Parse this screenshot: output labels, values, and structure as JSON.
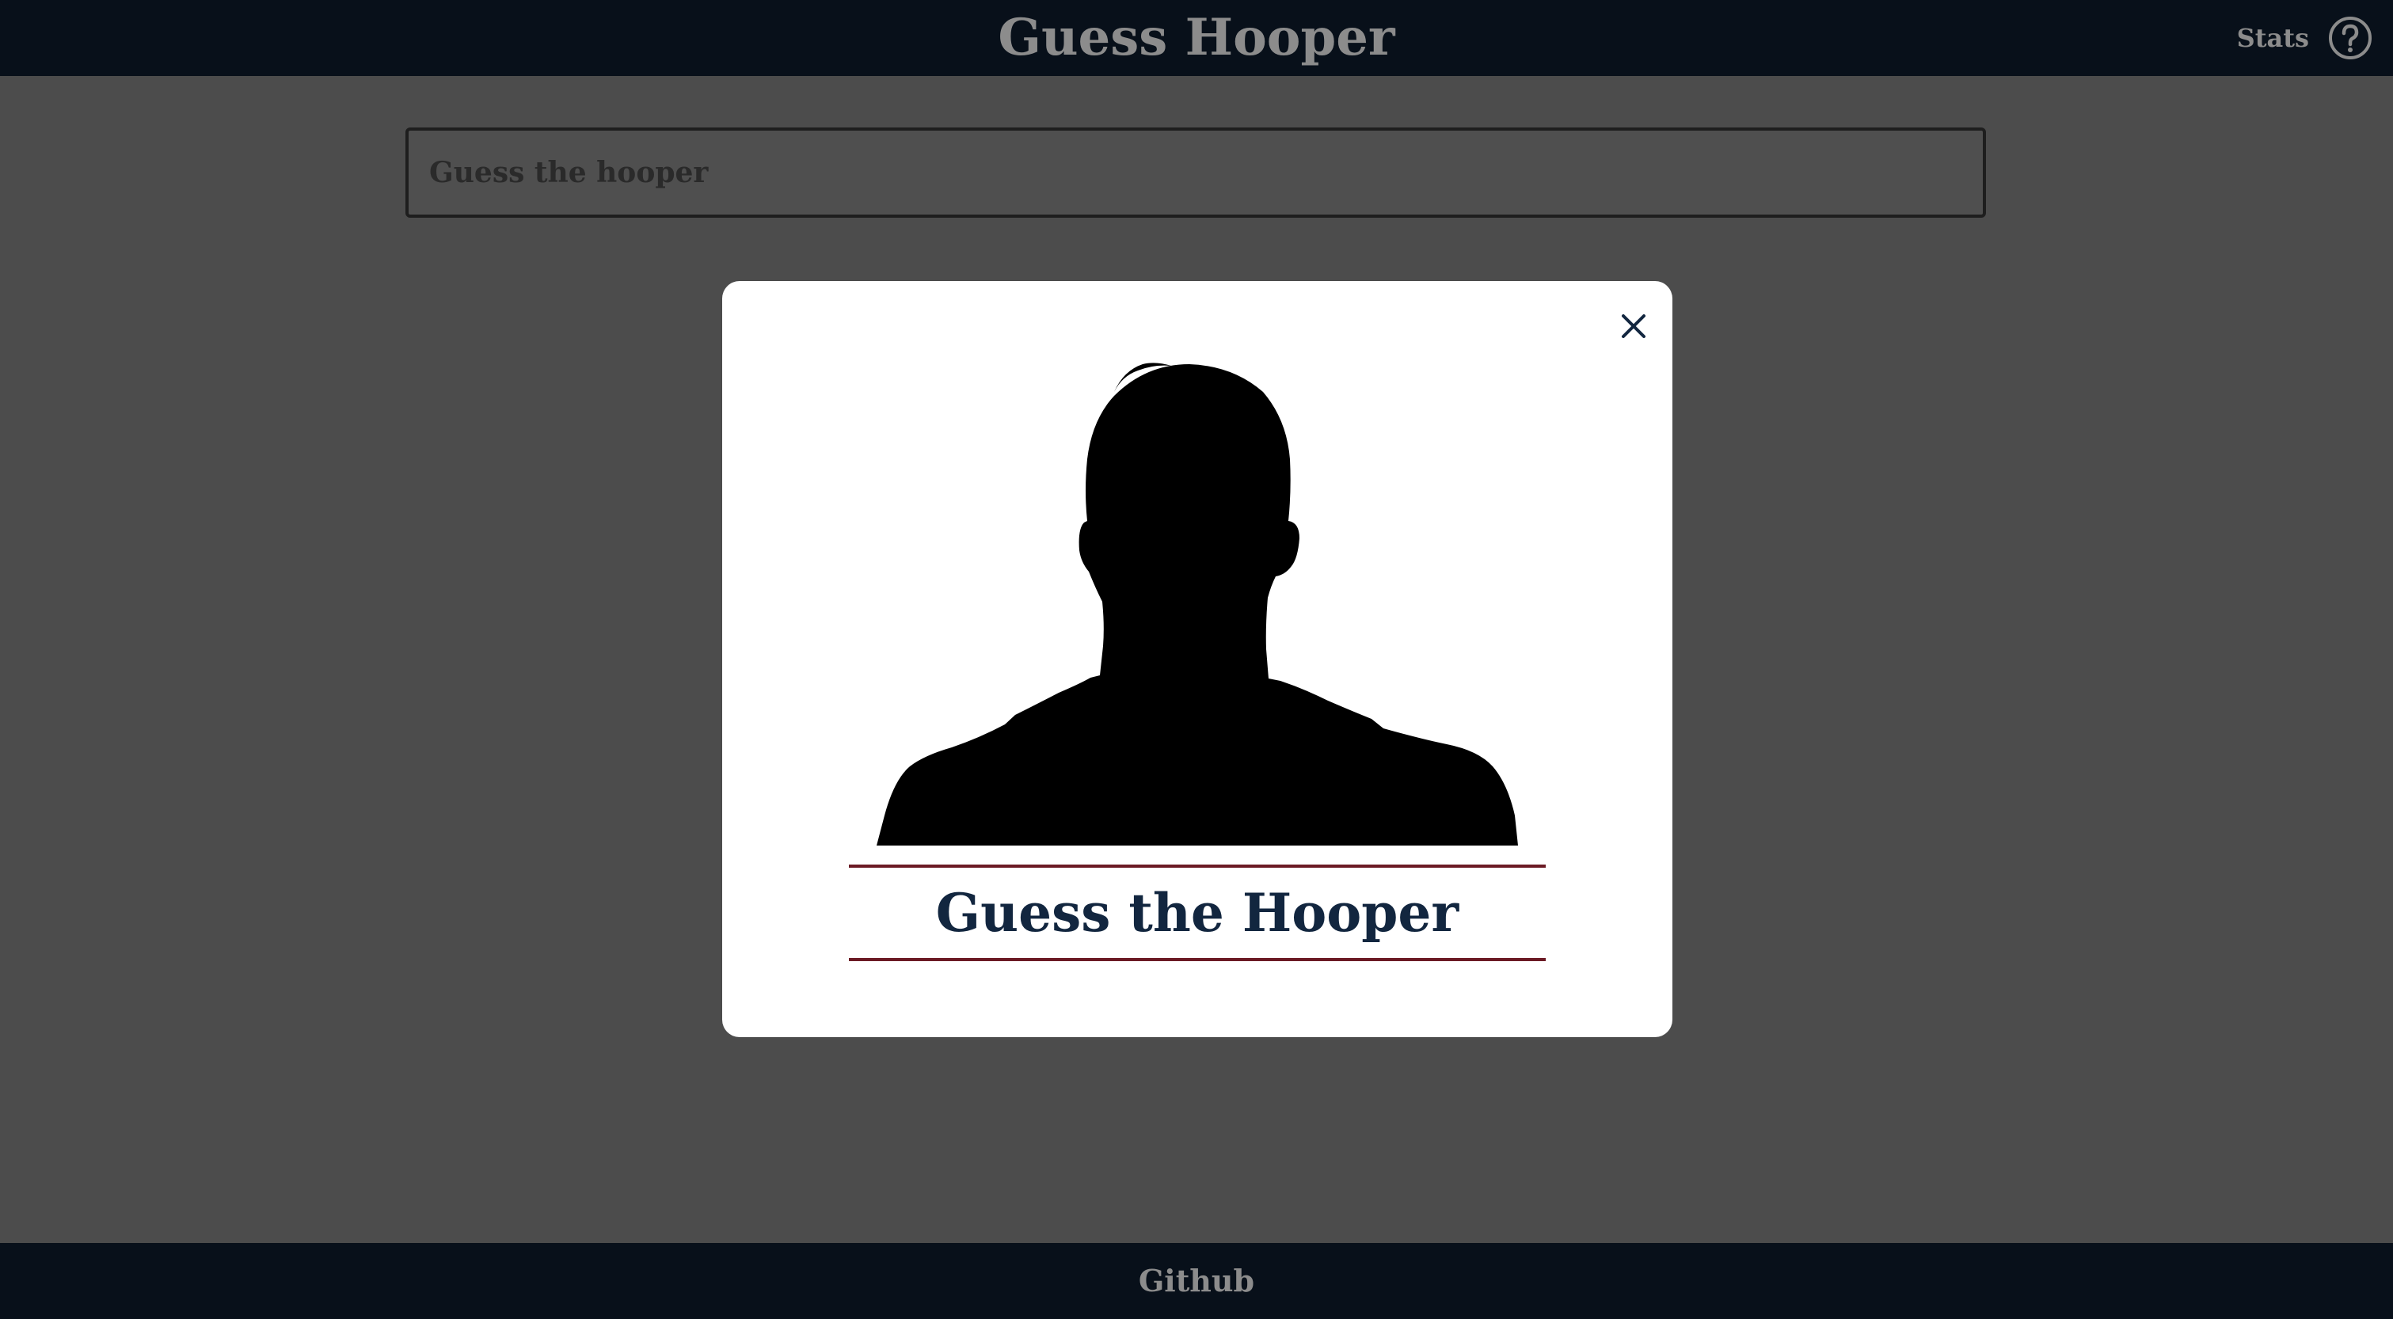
{
  "header": {
    "title": "Guess Hooper",
    "stats_label": "Stats"
  },
  "search": {
    "placeholder": "Guess the hooper",
    "value": ""
  },
  "modal": {
    "title": "Guess the Hooper",
    "close_icon": "close-icon",
    "image_icon": "player-silhouette"
  },
  "footer": {
    "link_label": "Github"
  },
  "colors": {
    "header_bg": "#08101a",
    "overlay_bg": "#4c4c4c",
    "modal_bg": "#ffffff",
    "title_color": "#12263f",
    "rule_color": "#6b1a24",
    "muted_text": "#8c8c8c"
  }
}
